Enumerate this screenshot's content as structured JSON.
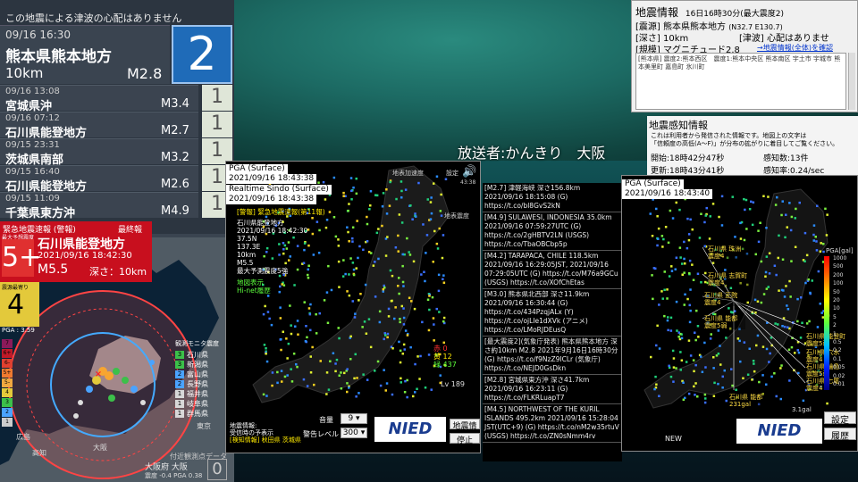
{
  "left": {
    "tsunami_notice": "この地震による津波の心配はありません",
    "latest": {
      "time": "09/16 16:30",
      "place": "熊本県熊本地方",
      "depth": "10km",
      "mag": "M2.8",
      "intensity": "2"
    },
    "history": [
      {
        "time": "09/16 13:08",
        "place": "宮城県沖",
        "mag": "M3.4",
        "intensity": "1"
      },
      {
        "time": "09/16 07:12",
        "place": "石川県能登地方",
        "mag": "M2.7",
        "intensity": "1"
      },
      {
        "time": "09/15 23:31",
        "place": "茨城県南部",
        "mag": "M3.2",
        "intensity": "1"
      },
      {
        "time": "09/15 16:40",
        "place": "石川県能登地方",
        "mag": "M2.6",
        "intensity": "1"
      },
      {
        "time": "09/15 11:09",
        "place": "千葉県東方沖",
        "mag": "M4.9",
        "intensity": "1"
      }
    ],
    "eew": {
      "header": "緊急地震速報 (警報)",
      "order": "最終報",
      "max_label": "最大予想震度",
      "max_int": "5+",
      "area": "石川県能登地方",
      "time": "2021/09/16 18:42:30",
      "mag": "M5.5",
      "depth": "深さ：10km",
      "pred_label": "震源最寄り",
      "pred_int": "4",
      "pga": "PGA : 3.59"
    },
    "legend_title": "観測モニタ震度",
    "legend": [
      {
        "n": "3",
        "name": "石川県",
        "c": "#3cc04a"
      },
      {
        "n": "3",
        "name": "新潟県",
        "c": "#3cc04a"
      },
      {
        "n": "2",
        "name": "富山県",
        "c": "#4aa3ff"
      },
      {
        "n": "2",
        "name": "長野県",
        "c": "#4aa3ff"
      },
      {
        "n": "1",
        "name": "福井県",
        "c": "#d8d8d8"
      },
      {
        "n": "1",
        "name": "岐阜県",
        "c": "#d8d8d8"
      },
      {
        "n": "1",
        "name": "群馬県",
        "c": "#d8d8d8"
      }
    ],
    "left_scale": [
      "7",
      "6+",
      "6-",
      "5+",
      "5-",
      "4",
      "3",
      "2",
      "1"
    ],
    "map_labels": [
      "広島",
      "大阪",
      "高知",
      "東京"
    ],
    "footer1": "付近観測点データ",
    "footer2": "大阪府 大阪",
    "footer3": "震度 -0.4  PGA 0.38",
    "footer_int": "0"
  },
  "broadcast": "放送者:かんきり　大阪",
  "info": {
    "title": "地震情報",
    "sub": "16日16時30分(最大震度2)",
    "epicenter_label": "[震源]",
    "epicenter": "熊本県熊本地方",
    "coords": "(N32.7 E130.7)",
    "depth_label": "[深さ]",
    "depth": "10km",
    "tsunami_label": "[津波]",
    "tsunami": "心配はありませ",
    "scale_label": "[規模]",
    "scale": "マグニチュード2.8",
    "link": "→地震情報(全体)を確認",
    "memo": "[熊本県] 震度2:熊本西区　震度1:熊本中央区 熊本南区 宇土市 宇城市 熊本美里町 嘉島町 氷川町"
  },
  "sense": {
    "title": "地震感知情報",
    "line1": "これは利用者から発信された情報です。地図上の文字は",
    "line2": "「信頼度の高低(A～F)」が分布の拡がりに着目してご覧ください。",
    "start": "開始:18時42分47秒",
    "count": "感知数:13件",
    "update": "更新:18時43分41秒",
    "rate": "感知率:0.24/sec"
  },
  "kmoni": {
    "pga_label": "PGA (Surface)",
    "pga_time": "2021/09/16 18:43:38",
    "rs_label": "Realtime Sindo (Surface)",
    "rs_time": "2021/09/16 18:43:38",
    "warn": "[警報] 緊急地震速報(第11報)",
    "warn_lines": [
      "石川県能登地方",
      "2021/09/16 18:42:30",
      "37.5N",
      "137.3E",
      "10km",
      "M5.5",
      "最大予測震度5強"
    ],
    "links": [
      "地図表示",
      "Hi-net履歴"
    ],
    "wave_label": "地表加速度",
    "wave_label2": "地表震度",
    "time_small": "43:38",
    "setting": "設定",
    "counts": {
      "red": "赤 0",
      "yellow": "黄 12",
      "green": "緑 437"
    },
    "lv": "Lv 189",
    "vol_label": "音量",
    "vol": "9",
    "alert_label": "警告レベル",
    "alert": "300",
    "info_label": "地震情報:",
    "info_sub": "受信時の予表示",
    "info_line": "[検知情報] 秋田県 茨城県",
    "btn1": "地震情報",
    "btn2": "停止",
    "logo": "NIED"
  },
  "tweets": [
    "[M2.7] 津軽海峡 深さ156.8km 2021/09/16 18:15:08 (G) https://t.co/bl8GvS2kN",
    "[M4.9] SULAWESI, INDONESIA 35.0km 2021/09/16 07:59:27UTC (G) https://t.co/2gHBTV2LN (USGS) https://t.co/TbaOBCbp5p",
    "[M4.2] TARAPACA, CHILE 118.5km 2021/09/16 16:29:05JST, 2021/09/16 07:29:05UTC (G) https://t.co/M76a9GCu (USGS) https://t.co/XOfChEtas",
    "[M3.0] 熊本県北西部 深さ11.9km 2021/09/16 16:30:44 (G) https://t.co/434PzqjALx (Y) https://t.co/ojLIe1dXVk (アニメ) https://t.co/LMoRJDEusQ",
    "[最大震度2](気象庁発表) 熊本県熊本地方 深さ約10km M2.8 2021年9月16日16時30分 (G) https://t.co/f9NzZ9ICLr (気象庁) https://t.co/NEJD0GsDkn",
    "[M2.8] 宮城県東方沖 深さ41.7km 2021/09/16 16:23:11 (G) https://t.co/FLKRLuapT7",
    "[M4.5] NORTHWEST OF THE KURIL ISLANDS 495.2km 2021/09/16 15:28:04 JST(UTC+9) (G) https://t.co/nM2w35rtuV (USGS) https://t.co/ZN0sNmm4rv"
  ],
  "right": {
    "pga_label": "PGA (Surface)",
    "pga_time": "2021/09/16 18:43:40",
    "unit": "PGA[gal]",
    "scale": [
      "1000",
      "500",
      "200",
      "100",
      "50",
      "20",
      "10",
      "5",
      "2",
      "1",
      "0.5",
      "0.2",
      "0.1",
      "0.05",
      "0.02",
      "0.01"
    ],
    "labels": [
      "石川県 珠洲 震度4",
      "石川県 志賀町 震度4",
      "石川県 正院 震度4",
      "石川県 能都 震度5弱",
      "石川県 能登町 震度5弱",
      "石川県 穴水 震度4",
      "石川県 輪島 震度5弱",
      "石川県 七尾 震度4",
      "石川県 能都 231gal",
      "石川県 羽咋 震度5弱"
    ],
    "gal": "3.1gal",
    "new": "NEW",
    "logo": "NIED",
    "btn_setting": "設定",
    "btn_history": "履歴"
  }
}
